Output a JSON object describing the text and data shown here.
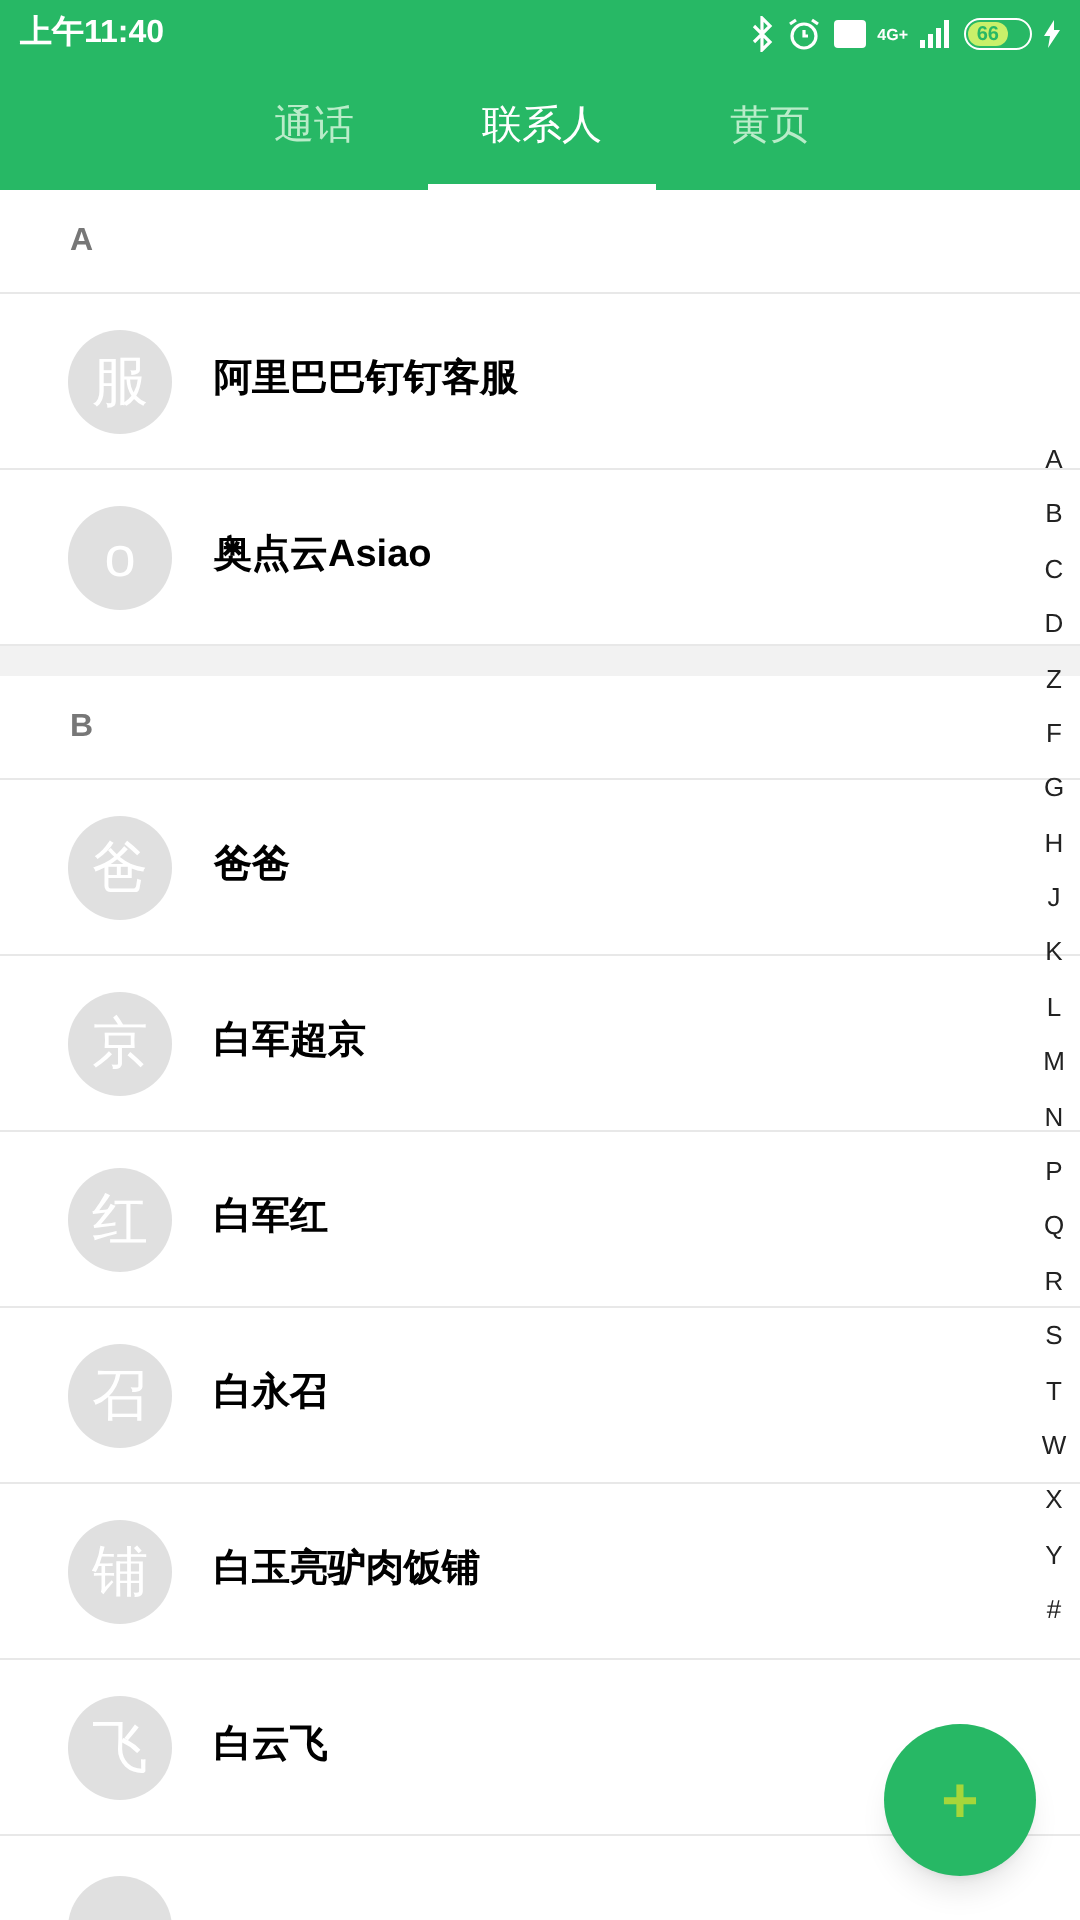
{
  "status_bar": {
    "time": "上午11:40",
    "battery": "66",
    "network": "4G+"
  },
  "tabs": [
    {
      "label": "通话",
      "selected": false
    },
    {
      "label": "联系人",
      "selected": true
    },
    {
      "label": "黄页",
      "selected": false
    }
  ],
  "sections": [
    {
      "letter": "A",
      "contacts": [
        {
          "avatar": "服",
          "name": "阿里巴巴钉钉客服"
        },
        {
          "avatar": "o",
          "name": "奥点云Asiao"
        }
      ]
    },
    {
      "letter": "B",
      "contacts": [
        {
          "avatar": "爸",
          "name": "爸爸"
        },
        {
          "avatar": "京",
          "name": "白军超京"
        },
        {
          "avatar": "红",
          "name": "白军红"
        },
        {
          "avatar": "召",
          "name": "白永召"
        },
        {
          "avatar": "铺",
          "name": "白玉亮驴肉饭铺"
        },
        {
          "avatar": "飞",
          "name": "白云飞"
        }
      ]
    }
  ],
  "index": [
    "A",
    "B",
    "C",
    "D",
    "Z",
    "F",
    "G",
    "H",
    "J",
    "K",
    "L",
    "M",
    "N",
    "P",
    "Q",
    "R",
    "S",
    "T",
    "W",
    "X",
    "Y",
    "#"
  ],
  "fab": {
    "label": "+"
  }
}
